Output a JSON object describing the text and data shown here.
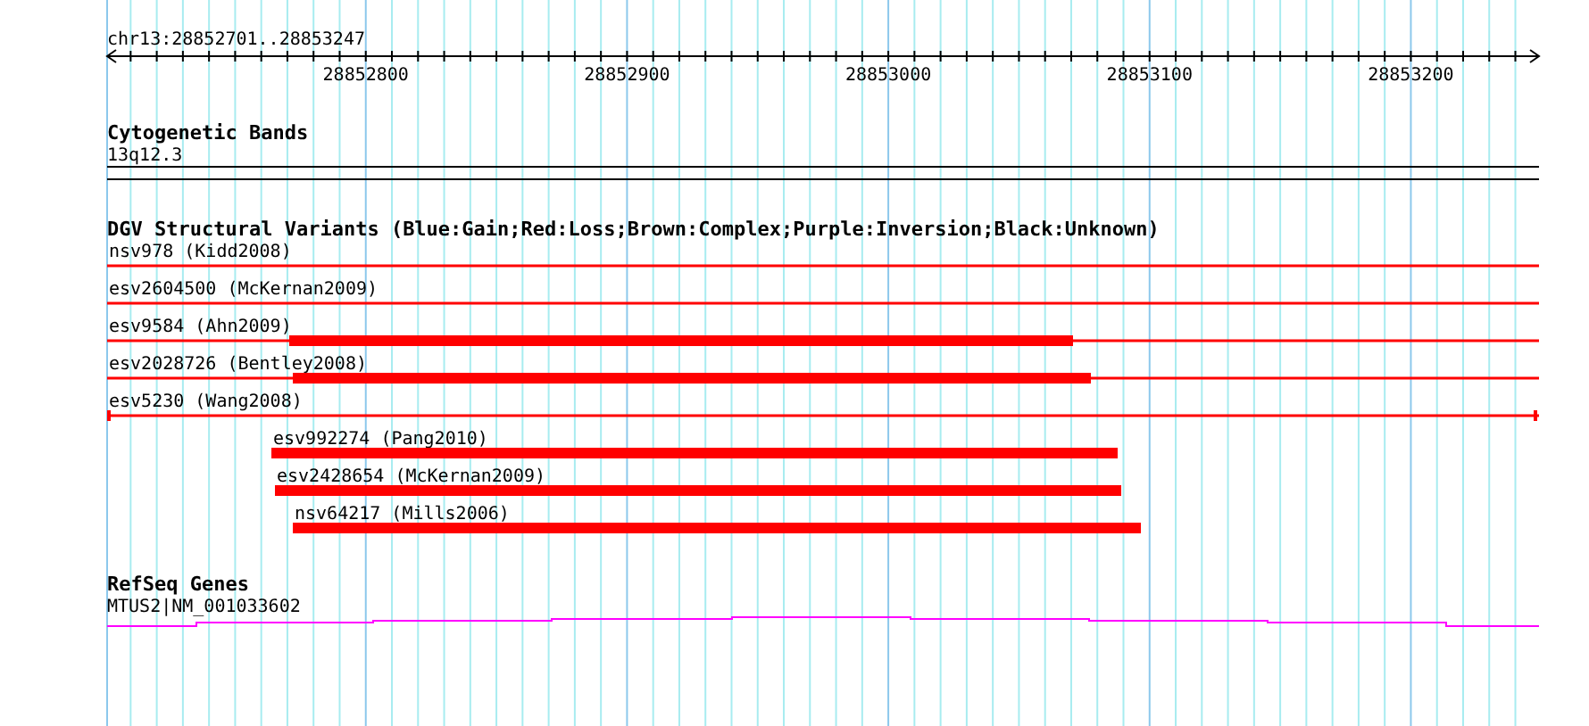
{
  "region": "chr13:28852701..28853247",
  "ruler": {
    "ticks": [
      "28852800",
      "28852900",
      "28853000",
      "28853100",
      "28853200"
    ]
  },
  "tracks": [
    {
      "kind": "bands",
      "title": "Cytogenetic Bands",
      "label": "13q12.3"
    },
    {
      "kind": "variants",
      "title": "DGV Structural Variants (Blue:Gain;Red:Loss;Brown:Complex;Purple:Inversion;Black:Unknown)",
      "items": [
        {
          "label": "nsv978 (Kidd2008)",
          "kind": "span"
        },
        {
          "label": "esv2604500 (McKernan2009)",
          "kind": "span"
        },
        {
          "label": "esv9584 (Ahn2009)",
          "kind": "span-core"
        },
        {
          "label": "esv2028726 (Bentley2008)",
          "kind": "span-core"
        },
        {
          "label": "esv5230 (Wang2008)",
          "kind": "capped"
        },
        {
          "label": "esv992274 (Pang2010)",
          "kind": "core"
        },
        {
          "label": "esv2428654 (McKernan2009)",
          "kind": "core"
        },
        {
          "label": "nsv64217 (Mills2006)",
          "kind": "core"
        }
      ]
    },
    {
      "kind": "genes",
      "title": "RefSeq Genes",
      "label": "MTUS2|NM_001033602"
    }
  ]
}
